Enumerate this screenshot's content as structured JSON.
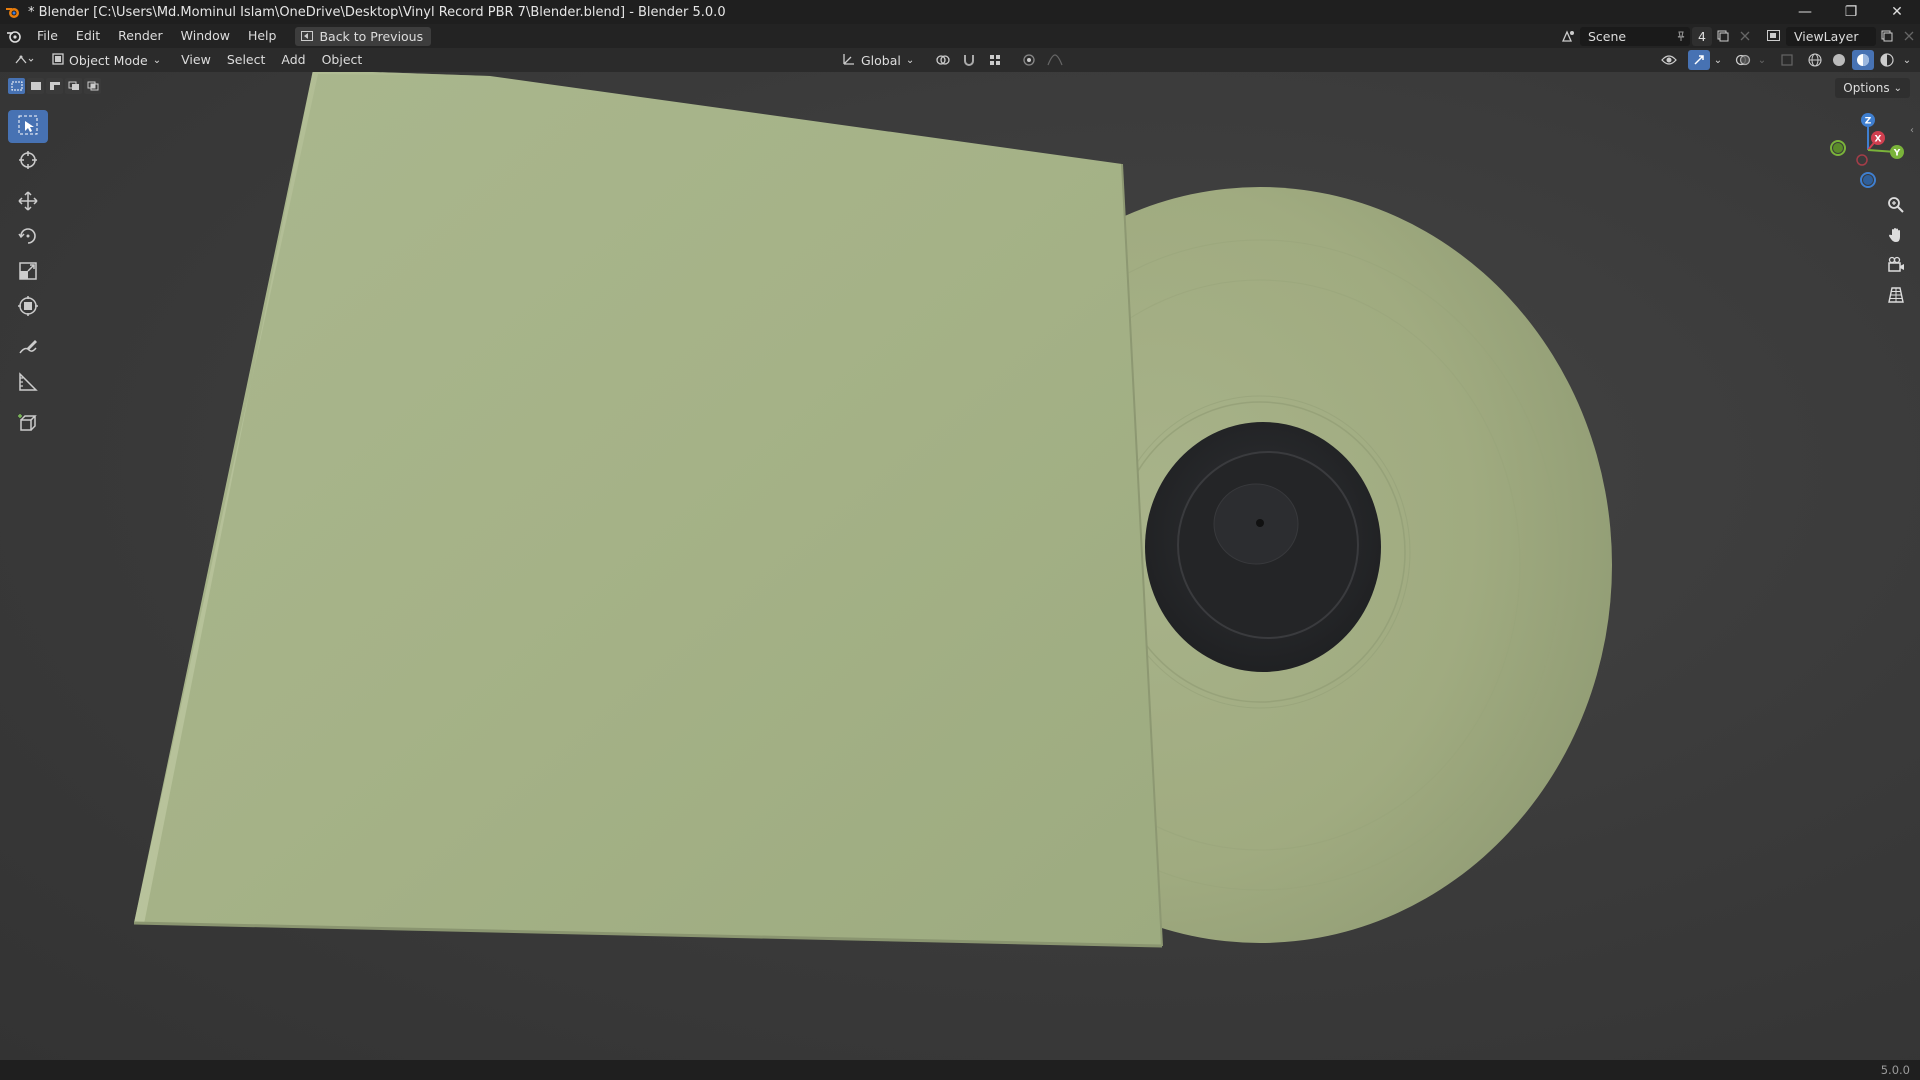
{
  "window": {
    "title": "* Blender [C:\\Users\\Md.Mominul Islam\\OneDrive\\Desktop\\Vinyl Record PBR 7\\Blender.blend] - Blender 5.0.0",
    "minimize": "—",
    "restore": "❐",
    "close": "✕"
  },
  "menubar": {
    "items": [
      "File",
      "Edit",
      "Render",
      "Window",
      "Help"
    ],
    "back_button": "Back to Previous",
    "scene_label": "Scene",
    "scene_count": "4",
    "view_layer_label": "ViewLayer"
  },
  "header": {
    "mode": "Object Mode",
    "menus": [
      "View",
      "Select",
      "Add",
      "Object"
    ],
    "transform_orientation": "Global",
    "options_label": "Options"
  },
  "tools": [
    {
      "name": "select-box",
      "active": true
    },
    {
      "name": "cursor",
      "active": false
    },
    {
      "name": "move",
      "active": false
    },
    {
      "name": "rotate",
      "active": false
    },
    {
      "name": "scale",
      "active": false
    },
    {
      "name": "transform",
      "active": false
    },
    {
      "name": "annotate",
      "active": false
    },
    {
      "name": "measure",
      "active": false
    },
    {
      "name": "add-cube",
      "active": false
    }
  ],
  "gizmo": {
    "x_label": "X",
    "y_label": "Y",
    "z_label": "Z"
  },
  "colors": {
    "accent": "#4772b3",
    "sleeve": "#a7b488",
    "record": "#a0ab82",
    "label": "#262729"
  },
  "status": {
    "version": "5.0.0"
  }
}
